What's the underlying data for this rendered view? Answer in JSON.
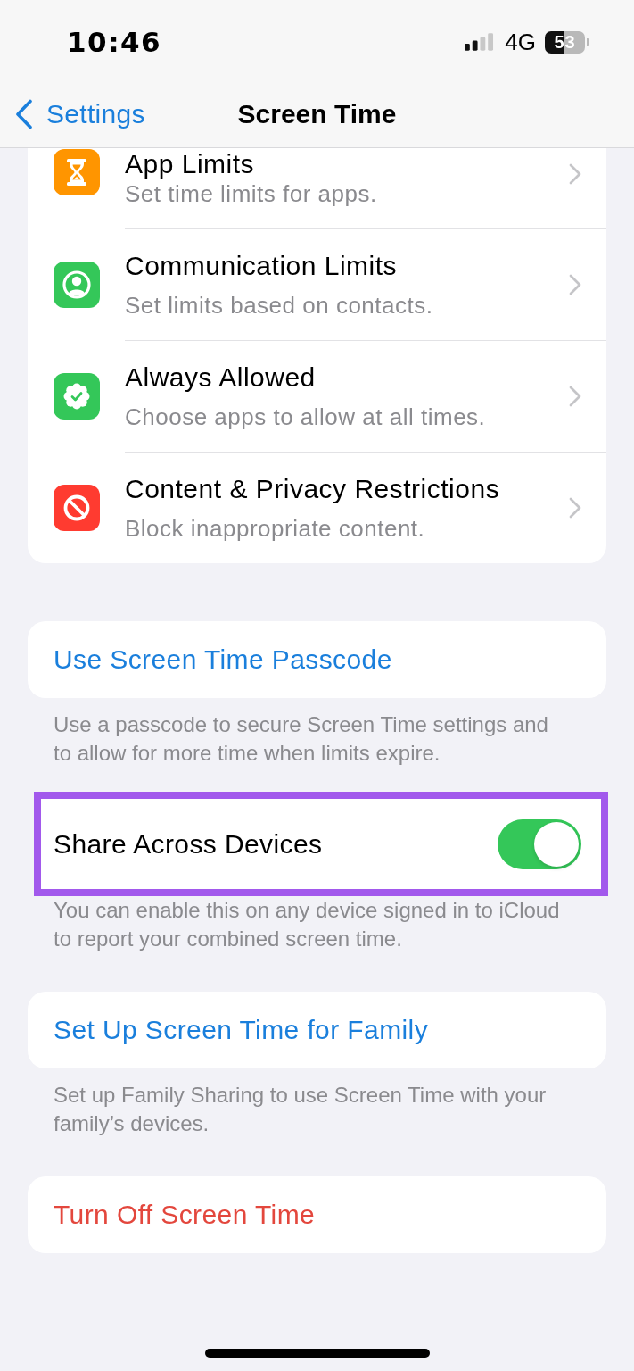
{
  "status_bar": {
    "time": "10:46",
    "network": "4G",
    "battery": "53"
  },
  "nav_bar": {
    "back_label": "Settings",
    "title": "Screen Time"
  },
  "sections": [
    {
      "kind": "list",
      "rows": [
        {
          "title": "App Limits",
          "subtitle": "Set time limits for apps.",
          "color": "#ff9500"
        },
        {
          "title": "Communication Limits",
          "subtitle": "Set limits based on contacts.",
          "color": "#34c759"
        },
        {
          "title": "Always Allowed",
          "subtitle": "Choose apps to allow at all times.",
          "color": "#34c759"
        },
        {
          "title": "Content & Privacy Restrictions",
          "subtitle": "Block inappropriate content.",
          "color": "#ff3b30"
        }
      ]
    },
    {
      "kind": "link",
      "label": "Use Screen Time Passcode",
      "footer": "Use a passcode to secure Screen Time settings and to allow for more time when limits expire."
    },
    {
      "kind": "toggle",
      "label": "Share Across Devices",
      "on": true,
      "highlighted": true,
      "footer": "You can enable this on any device signed in to iCloud to report your combined screen time."
    },
    {
      "kind": "link",
      "label": "Set Up Screen Time for Family",
      "footer": "Set up Family Sharing to use Screen Time with your family’s devices."
    },
    {
      "kind": "destructive",
      "label": "Turn Off Screen Time"
    }
  ]
}
